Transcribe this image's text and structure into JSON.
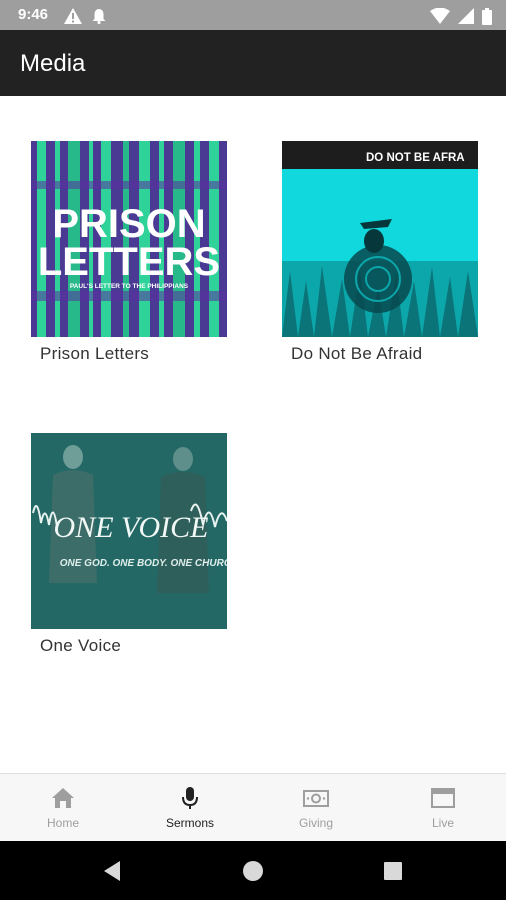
{
  "status_bar": {
    "time": "9:46",
    "icons": [
      "warning-icon",
      "notification-bell-icon",
      "wifi-icon",
      "signal-icon",
      "battery-icon"
    ]
  },
  "app_bar": {
    "title": "Media"
  },
  "media": {
    "items": [
      {
        "label": "Prison Letters",
        "thumb_title_1": "PRISON",
        "thumb_title_2": "LETTERS",
        "thumb_subtitle": "PAUL'S LETTER TO THE PHILIPPIANS"
      },
      {
        "label": "Do Not Be Afraid",
        "thumb_banner": "DO NOT BE AFRA"
      },
      {
        "label": "One Voice",
        "thumb_title": "ONE VOICE",
        "thumb_subtitle": "ONE GOD. ONE BODY. ONE CHURCH"
      }
    ]
  },
  "bottom_nav": {
    "active": "Sermons",
    "items": [
      {
        "label": "Home",
        "icon": "home-icon"
      },
      {
        "label": "Sermons",
        "icon": "microphone-icon"
      },
      {
        "label": "Giving",
        "icon": "money-icon"
      },
      {
        "label": "Live",
        "icon": "browser-window-icon"
      }
    ]
  },
  "system_nav": {
    "buttons": [
      "back-icon",
      "home-circle-icon",
      "recents-square-icon"
    ]
  },
  "colors": {
    "status_bar": "#9e9e9e",
    "app_bar": "#222222",
    "prison_letters_bg": "#4b3a93",
    "prison_letters_accent": "#2fd39a",
    "do_not_be_afraid_bg": "#10d8dc",
    "one_voice_bg": "#1e5c5a",
    "nav_inactive": "#9e9e9e",
    "nav_active": "#222222"
  }
}
